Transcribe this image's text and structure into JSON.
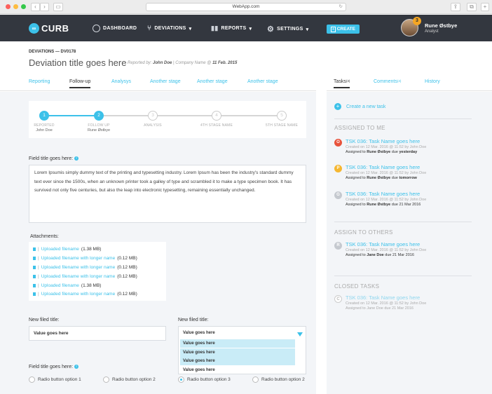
{
  "browser": {
    "url": "WebApp.com"
  },
  "nav": {
    "logo": "CURB",
    "items": [
      "DASHBOARD",
      "DEVIATIONS",
      "REPORTS",
      "SETTINGS"
    ],
    "create": "CREATE",
    "user": {
      "name": "Rune Østbye",
      "role": "Analyst",
      "notifications": "3"
    }
  },
  "header": {
    "breadcrumb": "DEVIATIONS — DV0178",
    "title": "Deviation title goes here",
    "meta_prefix": "Reported by:",
    "meta_reporter": "John Doe",
    "meta_mid": "| Company Name @",
    "meta_date": "11 Feb. 2015"
  },
  "tabs": [
    "Reporting",
    "Follow-up",
    "Analysys",
    "Another stage",
    "Another stage",
    "Another stage"
  ],
  "right_tabs": [
    {
      "label": "Tasks",
      "count": "(3)"
    },
    {
      "label": "Comments",
      "count": "(4)"
    },
    {
      "label": "History",
      "count": ""
    }
  ],
  "stepper": [
    {
      "num": "1",
      "label": "REPORTED",
      "sub": "John Doe"
    },
    {
      "num": "2",
      "label": "FOLLOW UP",
      "sub": "Rune Østbye"
    },
    {
      "num": "3",
      "label": "ANALYSIS",
      "sub": ""
    },
    {
      "num": "4",
      "label": "4TH STAGE NAME",
      "sub": ""
    },
    {
      "num": "5",
      "label": "5TH STAGE NAME",
      "sub": ""
    }
  ],
  "field": {
    "title": "Field title goes here:",
    "text": "Lorem Ipsumis simply dummy text of the printing and typesetting industry. Lorem Ipsum has been the industry's standard dummy text ever since the 1500s, when an unknown printer took a galley of type and scrambled it to make a type specimen book. It has survived not only five centuries, but also the leap into electronic typesetting, remaining essentially unchanged."
  },
  "attachments": {
    "title": "Attachments:",
    "items": [
      {
        "name": "Uploaded filename",
        "size": "(1.38 MB)"
      },
      {
        "name": "Uploaded filename with longer name",
        "size": "(0.12 MB)"
      },
      {
        "name": "Uploaded filename with longer name",
        "size": "(0.12 MB)"
      },
      {
        "name": "Uploaded filename with longer name",
        "size": "(0.12 MB)"
      },
      {
        "name": "Uploaded filename",
        "size": "(1.38 MB)"
      },
      {
        "name": "Uploaded filename with longer name",
        "size": "(0.12 MB)"
      }
    ]
  },
  "new_field_1": {
    "label": "New filed title:",
    "value": "Value goes here"
  },
  "new_field_2": {
    "label": "New filed title:",
    "value": "Value goes here",
    "options": [
      "Value goes here",
      "Value goes here",
      "Value goes here",
      "Value goes here"
    ]
  },
  "radio_group": {
    "title": "Field title goes here:",
    "options": [
      "Radio button option 1",
      "Radio button option 2",
      "Radio button option 3",
      "Radio button option 2"
    ],
    "selected_index": 2
  },
  "tasks_panel": {
    "create_label": "Create a new task",
    "assigned_to_me": "ASSIGNED TO ME",
    "assign_to_others": "ASSIGN TO OTHERS",
    "closed_tasks": "CLOSED TASKS",
    "me": [
      {
        "badge": "O",
        "color": "#e8533c",
        "title": "TSK 036: Task Name goes here",
        "created": "Created on 12 Mar. 2016 @ 11:52 by John Doe",
        "assigned_prefix": "Assigned to",
        "assignee": "Rune Østbye",
        "due_prefix": "due",
        "due": "yesterday"
      },
      {
        "badge": "P",
        "color": "#f5b731",
        "title": "TSK 036: Task Name goes here",
        "created": "Created on 12 Mar. 2016 @ 11:52 by John Doe",
        "assigned_prefix": "Assigned to",
        "assignee": "Rune Østbye",
        "due_prefix": "due",
        "due": "tomorrow"
      },
      {
        "badge": "G",
        "color": "#c5c9cf",
        "title": "TSK 036: Task Name goes here",
        "created": "Created on 12 Mar. 2016 @ 11:52 by John Doe",
        "assigned_prefix": "Assigned to",
        "assignee": "Rune Østbye",
        "due_prefix": "due",
        "due": "21 Mar 2016"
      }
    ],
    "others": [
      {
        "badge": "R",
        "color": "#c5c9cf",
        "title": "TSK 036: Task Name goes here",
        "created": "Created on 12 Mar. 2016 @ 11:52 by John Doe",
        "assigned_prefix": "Assigned to",
        "assignee": "Jane Doe",
        "due_prefix": "due",
        "due": "21 Mar 2016"
      }
    ],
    "closed": [
      {
        "badge": "C",
        "color": "#ffffff",
        "title": "TSK 036: Task Name goes here",
        "created": "Created on 12 Mar. 2016 @ 11:52 by John Doe",
        "assigned_prefix": "Assigned to",
        "assignee": "Jane Doe",
        "due_prefix": "due",
        "due": "21 Mar 2016"
      }
    ]
  },
  "colors": {
    "accent": "#3cc1e9",
    "nav": "#33373f",
    "panel": "#f3f5f8"
  }
}
